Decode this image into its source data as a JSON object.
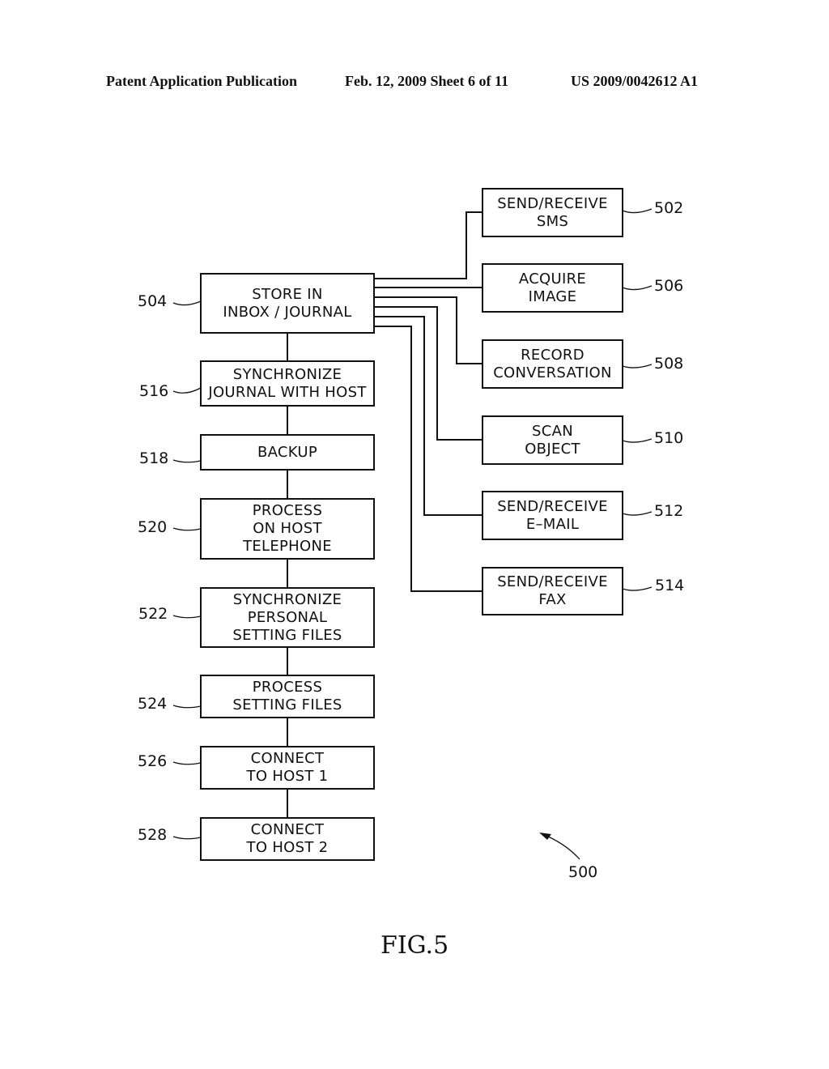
{
  "header": {
    "publication": "Patent Application Publication",
    "date_sheet": "Feb. 12, 2009   Sheet 6 of 11",
    "number": "US 2009/0042612 A1"
  },
  "figure": {
    "label": "FIG.5",
    "ref": "500"
  },
  "left_column": [
    {
      "ref": "504",
      "text": "STORE  IN\nINBOX  /  JOURNAL"
    },
    {
      "ref": "516",
      "text": "SYNCHRONIZE\nJOURNAL  WITH  HOST"
    },
    {
      "ref": "518",
      "text": "BACKUP"
    },
    {
      "ref": "520",
      "text": "PROCESS\nON  HOST\nTELEPHONE"
    },
    {
      "ref": "522",
      "text": "SYNCHRONIZE\nPERSONAL\nSETTING  FILES"
    },
    {
      "ref": "524",
      "text": "PROCESS\nSETTING  FILES"
    },
    {
      "ref": "526",
      "text": "CONNECT\nTO  HOST  1"
    },
    {
      "ref": "528",
      "text": "CONNECT\nTO  HOST  2"
    }
  ],
  "right_column": [
    {
      "ref": "502",
      "text": "SEND/RECEIVE\nSMS"
    },
    {
      "ref": "506",
      "text": "ACQUIRE\nIMAGE"
    },
    {
      "ref": "508",
      "text": "RECORD\nCONVERSATION"
    },
    {
      "ref": "510",
      "text": "SCAN\nOBJECT"
    },
    {
      "ref": "512",
      "text": "SEND/RECEIVE\nE–MAIL"
    },
    {
      "ref": "514",
      "text": "SEND/RECEIVE\nFAX"
    }
  ]
}
